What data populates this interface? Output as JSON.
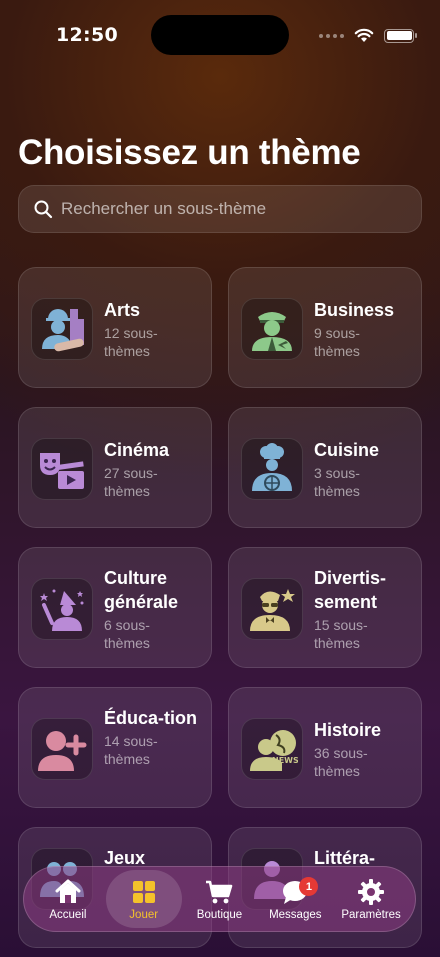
{
  "status": {
    "time": "12:50"
  },
  "title": "Choisissez un thème",
  "search": {
    "placeholder": "Rechercher un sous-thème"
  },
  "themes": [
    {
      "name": "Arts",
      "count": "12 sous-thèmes"
    },
    {
      "name": "Business",
      "count": "9 sous-thèmes"
    },
    {
      "name": "Cinéma",
      "count": "27 sous-thèmes"
    },
    {
      "name": "Cuisine",
      "count": "3 sous-thèmes"
    },
    {
      "name": "Culture générale",
      "count": "6 sous-thèmes"
    },
    {
      "name": "Divertis-sement",
      "count": "15 sous-thèmes"
    },
    {
      "name": "Éduca-tion",
      "count": "14 sous-thèmes"
    },
    {
      "name": "Histoire",
      "count": "36 sous-thèmes"
    },
    {
      "name": "Jeux",
      "count": ""
    },
    {
      "name": "Littéra-",
      "count": ""
    }
  ],
  "tabs": [
    {
      "label": "Accueil",
      "icon": "home-icon"
    },
    {
      "label": "Jouer",
      "icon": "grid-icon",
      "active": true
    },
    {
      "label": "Boutique",
      "icon": "cart-icon"
    },
    {
      "label": "Messages",
      "icon": "chat-icon",
      "badge": "1"
    },
    {
      "label": "Paramètres",
      "icon": "gear-icon"
    }
  ],
  "colors": {
    "accent": "#f4c22b",
    "badge": "#e53935"
  }
}
